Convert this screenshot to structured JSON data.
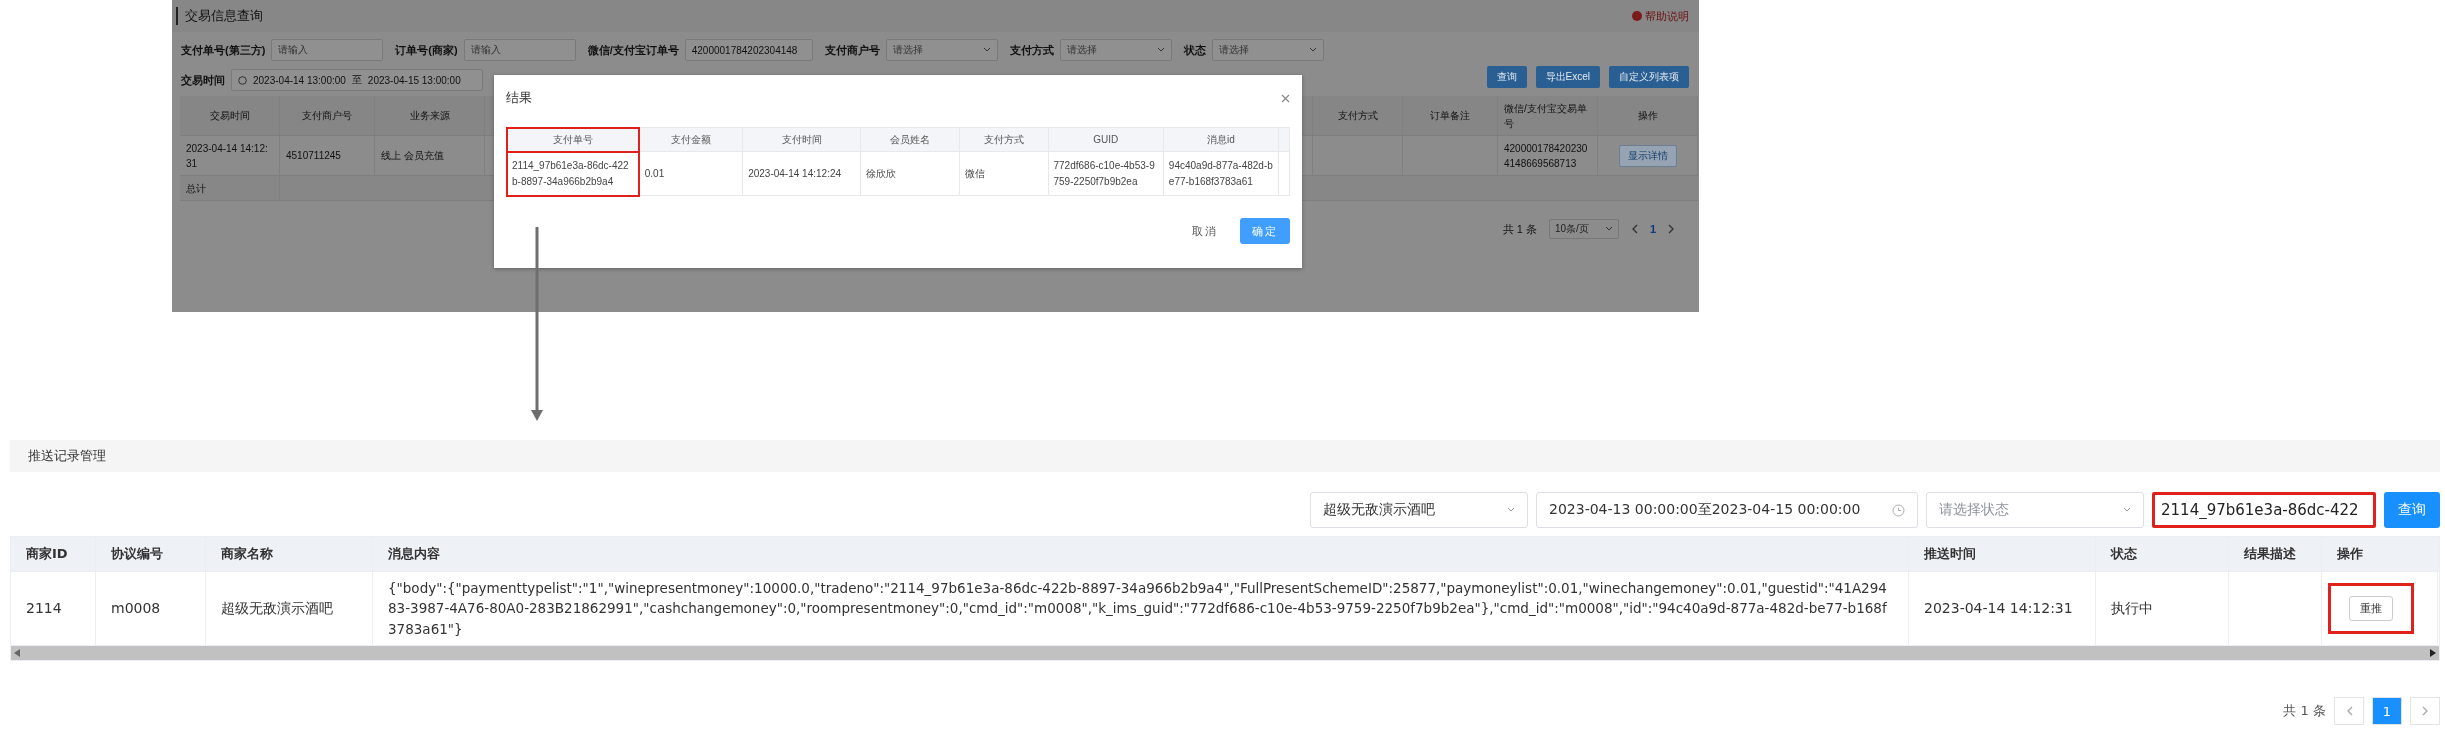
{
  "trade_query": {
    "title": "交易信息查询",
    "help": "帮助说明",
    "filters": [
      {
        "label": "支付单号(第三方)",
        "kind": "input",
        "placeholder": "请输入"
      },
      {
        "label": "订单号(商家)",
        "kind": "input",
        "placeholder": "请输入"
      },
      {
        "label": "微信/支付宝订单号",
        "kind": "input",
        "value": "4200001784202304148"
      },
      {
        "label": "支付商户号",
        "kind": "select",
        "placeholder": "请选择"
      },
      {
        "label": "支付方式",
        "kind": "select",
        "placeholder": "请选择"
      },
      {
        "label": "状态",
        "kind": "select",
        "placeholder": "请选择"
      }
    ],
    "time_filter": {
      "label": "交易时间",
      "start": "2023-04-14 13:00:00",
      "separator": "至",
      "end": "2023-04-15 13:00:00"
    },
    "buttons": [
      "查询",
      "导出Excel",
      "自定义列表项"
    ],
    "columns_left": [
      "交易时间",
      "支付商户号",
      "业务来源"
    ],
    "columns_right": [
      "支付方式",
      "订单备注",
      "微信/支付宝交易单号",
      "操作"
    ],
    "rows": [
      {
        "trade_time": "2023-04-14 14:12:31",
        "merchant_no": "4510711245",
        "source": "线上 会员充值",
        "trade_no": "4200001784202304148669568713",
        "action": "显示详情"
      }
    ],
    "total_label": "总计",
    "pagination": {
      "total": "共 1 条",
      "page_size": "10条/页",
      "pages": [
        {
          "label": "1",
          "selected": true
        }
      ]
    }
  },
  "dialog": {
    "title": "结果",
    "columns": [
      {
        "label": "支付单号",
        "highlighted": true
      },
      {
        "label": "支付金额",
        "highlighted": false
      },
      {
        "label": "支付时间",
        "highlighted": false
      },
      {
        "label": "会员姓名",
        "highlighted": false
      },
      {
        "label": "支付方式",
        "highlighted": false
      },
      {
        "label": "GUID",
        "highlighted": false
      },
      {
        "label": "消息id",
        "highlighted": false
      }
    ],
    "rows": [
      [
        "2114_97b61e3a-86dc-422b-8897-34a966b2b9a4",
        "0.01",
        "2023-04-14 14:12:24",
        "徐欣欣",
        "微信",
        "772df686-c10e-4b53-9759-2250f7b9b2ea",
        "94c40a9d-877a-482d-be77-b168f3783a61"
      ]
    ],
    "buttons": [
      {
        "label": "取消",
        "kind": "default"
      },
      {
        "label": "确定",
        "kind": "primary"
      }
    ]
  },
  "push_records": {
    "title": "推送记录管理",
    "merchant_select": "超级无敌演示酒吧",
    "date_range": "2023-04-13 00:00:00至2023-04-15 00:00:00",
    "status_select": {
      "placeholder": "请选择状态"
    },
    "search_field": {
      "value": "2114_97b61e3a-86dc-422",
      "highlighted": true
    },
    "search_button": "查询",
    "columns": [
      "商家ID",
      "协议编号",
      "商家名称",
      "消息内容",
      "推送时间",
      "状态",
      "结果描述",
      "操作"
    ],
    "rows": [
      {
        "merchant_id": "2114",
        "protocol_no": "m0008",
        "merchant_name": "超级无敌演示酒吧",
        "message": "{\"body\":{\"paymenttypelist\":\"1\",\"winepresentmoney\":10000.0,\"tradeno\":\"2114_97b61e3a-86dc-422b-8897-34a966b2b9a4\",\"FullPresentSchemeID\":25877,\"paymoneylist\":0.01,\"winechangemoney\":0.01,\"guestid\":\"41A29483-3987-4A76-80A0-283B21862991\",\"cashchangemoney\":0,\"roompresentmoney\":0,\"cmd_id\":\"m0008\",\"k_ims_guid\":\"772df686-c10e-4b53-9759-2250f7b9b2ea\"},\"cmd_id\":\"m0008\",\"id\":\"94c40a9d-877a-482d-be77-b168f3783a61\"}",
        "push_time": "2023-04-14 14:12:31",
        "status": "执行中",
        "action": {
          "label": "重推",
          "highlighted": true
        }
      }
    ],
    "pagination": {
      "total": "共 1 条",
      "pages": [
        {
          "label": "1",
          "selected": true
        }
      ]
    }
  }
}
